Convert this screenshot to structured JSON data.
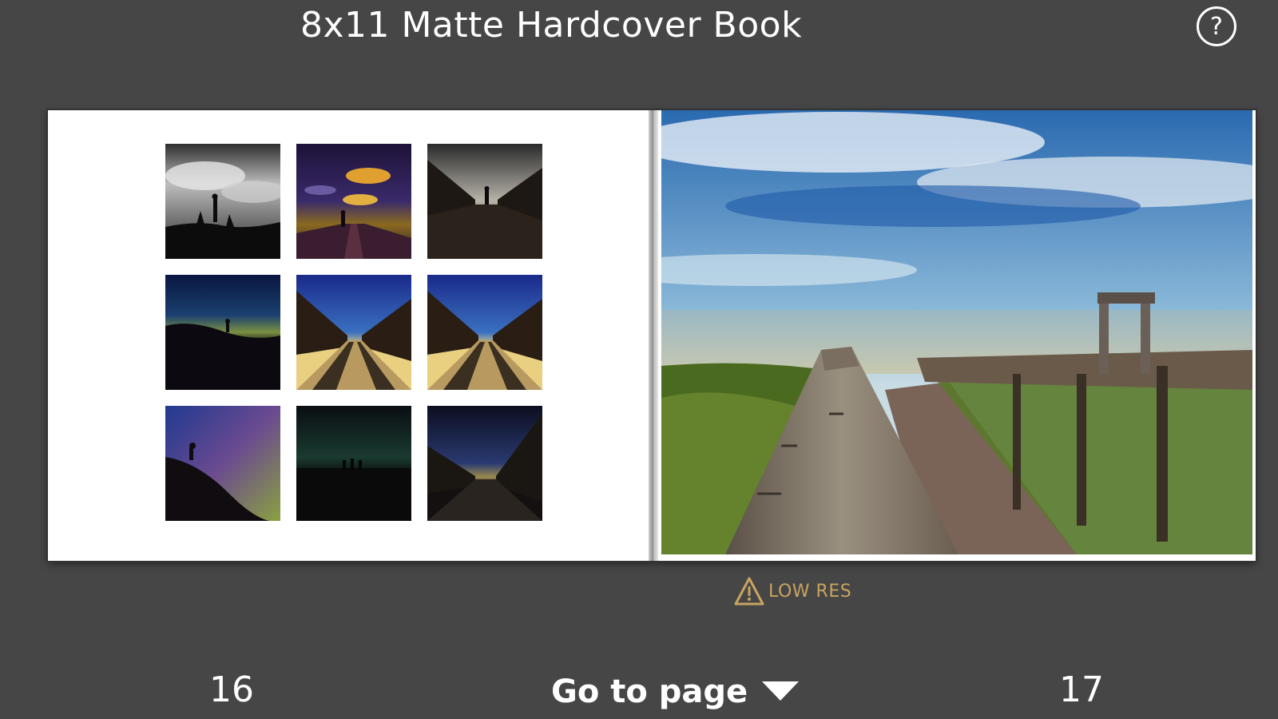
{
  "header": {
    "title": "8x11 Matte Hardcover Book",
    "help_symbol": "?",
    "help_icon": "help-circle-icon"
  },
  "spread": {
    "left_page": {
      "photos": [
        {
          "name": "silhouette-clouds-bw"
        },
        {
          "name": "boardwalk-golden-sky"
        },
        {
          "name": "bridge-silhouette-dusk"
        },
        {
          "name": "dune-silhouette-night"
        },
        {
          "name": "bridge-blue-sky-1"
        },
        {
          "name": "bridge-blue-sky-2"
        },
        {
          "name": "hillside-aurora"
        },
        {
          "name": "green-night-sky"
        },
        {
          "name": "bridge-night-sky"
        }
      ]
    },
    "right_page": {
      "photo": {
        "name": "boardwalk-beach-railing"
      },
      "warning": {
        "text": "LOW RES",
        "icon": "warning-triangle-icon",
        "color": "#c8a460"
      }
    }
  },
  "footer": {
    "left_page_number": "16",
    "right_page_number": "17",
    "goto_label": "Go to page",
    "goto_icon": "caret-down-icon"
  }
}
